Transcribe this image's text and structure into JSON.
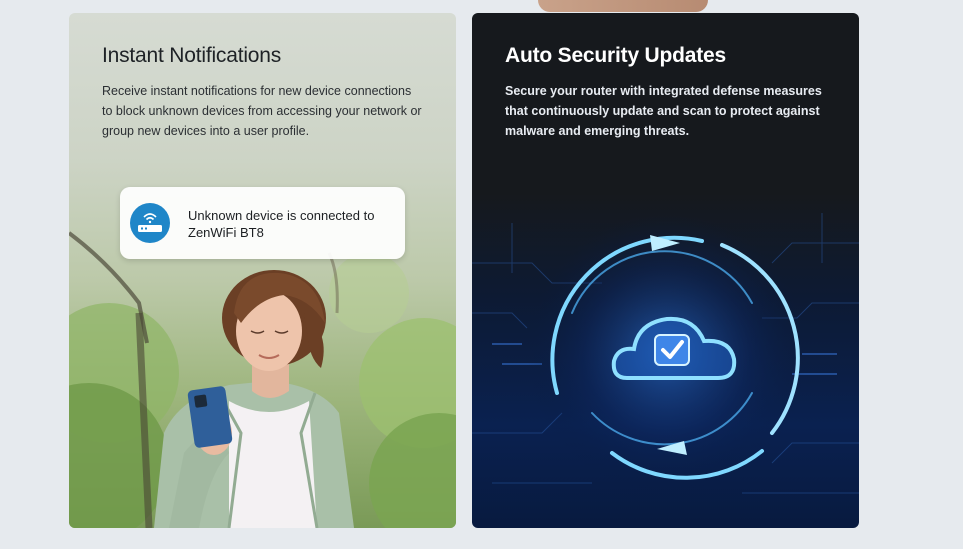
{
  "cards": [
    {
      "title": "Instant Notifications",
      "description": "Receive instant notifications for new device connections to block unknown devices from accessing your network or group new devices into a user profile.",
      "notification": {
        "icon": "router-wifi-icon",
        "text": "Unknown device is connected to ZenWiFi BT8"
      },
      "image": "woman-holding-phone-illustration"
    },
    {
      "title": "Auto Security Updates",
      "description": "Secure your router with integrated defense measures that continuously update and scan to protect against malware and emerging threats.",
      "image": "cloud-checkmark-security-illustration"
    }
  ],
  "colors": {
    "page_background": "#e6eaee",
    "dark_card": "#16191d",
    "accent_blue": "#1f86c8",
    "glow_blue": "#6fd3ff"
  }
}
